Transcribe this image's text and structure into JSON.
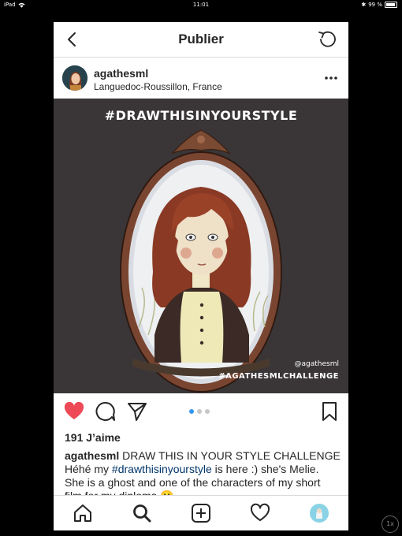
{
  "status_bar": {
    "device": "iPad",
    "time": "11:01",
    "battery": "99 %"
  },
  "top_bar": {
    "title": "Publier",
    "back_icon": "chevron-left-icon",
    "refresh_icon": "refresh-icon"
  },
  "post": {
    "username": "agathesml",
    "location": "Languedoc-Roussillon, France",
    "image": {
      "title": "#DRAWTHISINYOURSTYLE",
      "signature": "@agathesml",
      "challenge_tag": "#AGATHESMLCHALLENGE"
    },
    "carousel": {
      "count": 3,
      "active_index": 0
    },
    "likes": "191 J’aime",
    "caption": {
      "username": "agathesml",
      "line1": " DRAW THIS IN YOUR STYLE CHALLENGE",
      "pre_tag": "Héhé my ",
      "hashtag": "#drawthisinyourstyle",
      "post_tag": " is here :) she's Melie. She is a ghost and one of the characters of my short film for my diploma 😬"
    }
  },
  "colors": {
    "like_red": "#ed4956",
    "link_blue": "#003569",
    "dot_active": "#3897f0",
    "image_bg": "#3a3638"
  },
  "tab_bar": {
    "items": [
      "home-icon",
      "search-icon",
      "add-post-icon",
      "activity-heart-icon",
      "profile-avatar-icon"
    ]
  },
  "playback": {
    "speed": "1x"
  }
}
